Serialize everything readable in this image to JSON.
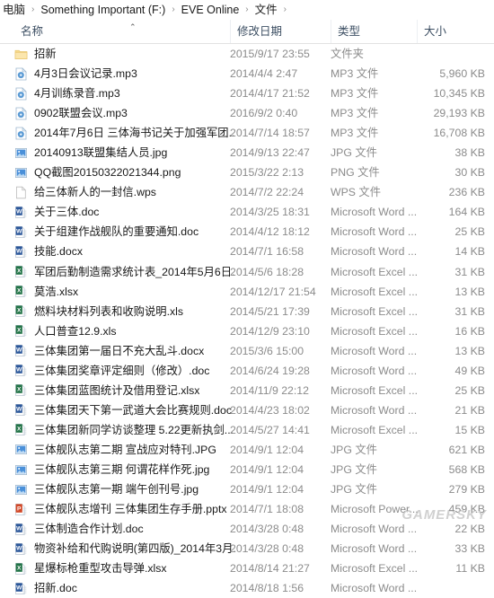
{
  "window": {
    "breadcrumb": {
      "separator": "›",
      "items": [
        "电脑",
        "Something Important (F:)",
        "EVE Online",
        "文件"
      ],
      "trailing_separator": "›"
    }
  },
  "columns": {
    "name": "名称",
    "date_modified": "修改日期",
    "type": "类型",
    "size": "大小",
    "sort_indicator": "⌃"
  },
  "watermark": "GAMERSKY",
  "icon_colors": {
    "folder": "#f6d98a",
    "folder_edge": "#e8c46b",
    "mp3": "#5b9bd5",
    "image": "#4a90d9",
    "word": "#2b579a",
    "excel": "#217346",
    "powerpoint": "#d24726",
    "generic": "#c8c8c8"
  },
  "files": [
    {
      "icon": "folder-icon",
      "name": "招新",
      "date": "2015/9/17 23:55",
      "type": "文件夹",
      "size": ""
    },
    {
      "icon": "mp3-icon",
      "name": "4月3日会议记录.mp3",
      "date": "2014/4/4 2:47",
      "type": "MP3 文件",
      "size": "5,960 KB"
    },
    {
      "icon": "mp3-icon",
      "name": "4月训练录音.mp3",
      "date": "2014/4/17 21:52",
      "type": "MP3 文件",
      "size": "10,345 KB"
    },
    {
      "icon": "mp3-icon",
      "name": "0902联盟会议.mp3",
      "date": "2016/9/2 0:40",
      "type": "MP3 文件",
      "size": "29,193 KB"
    },
    {
      "icon": "mp3-icon",
      "name": "2014年7月6日 三体海书记关于加强军团...",
      "date": "2014/7/14 18:57",
      "type": "MP3 文件",
      "size": "16,708 KB"
    },
    {
      "icon": "image-icon",
      "name": "20140913联盟集结人员.jpg",
      "date": "2014/9/13 22:47",
      "type": "JPG 文件",
      "size": "38 KB"
    },
    {
      "icon": "image-icon",
      "name": "QQ截图20150322021344.png",
      "date": "2015/3/22 2:13",
      "type": "PNG 文件",
      "size": "30 KB"
    },
    {
      "icon": "generic-icon",
      "name": "给三体新人的一封信.wps",
      "date": "2014/7/2 22:24",
      "type": "WPS 文件",
      "size": "236 KB"
    },
    {
      "icon": "word-icon",
      "name": "关于三体.doc",
      "date": "2014/3/25 18:31",
      "type": "Microsoft Word ...",
      "size": "164 KB"
    },
    {
      "icon": "word-icon",
      "name": "关于组建作战舰队的重要通知.doc",
      "date": "2014/4/12 18:12",
      "type": "Microsoft Word ...",
      "size": "25 KB"
    },
    {
      "icon": "word-icon",
      "name": "技能.docx",
      "date": "2014/7/1 16:58",
      "type": "Microsoft Word ...",
      "size": "14 KB"
    },
    {
      "icon": "excel-icon",
      "name": "军团后勤制造需求统计表_2014年5月6日...",
      "date": "2014/5/6 18:28",
      "type": "Microsoft Excel ...",
      "size": "31 KB"
    },
    {
      "icon": "excel-icon",
      "name": "莫浩.xlsx",
      "date": "2014/12/17 21:54",
      "type": "Microsoft Excel ...",
      "size": "13 KB"
    },
    {
      "icon": "excel-icon",
      "name": "燃料块材料列表和收购说明.xls",
      "date": "2014/5/21 17:39",
      "type": "Microsoft Excel ...",
      "size": "31 KB"
    },
    {
      "icon": "excel-icon",
      "name": "人口普查12.9.xls",
      "date": "2014/12/9 23:10",
      "type": "Microsoft Excel ...",
      "size": "16 KB"
    },
    {
      "icon": "word-icon",
      "name": "三体集团第一届日不充大乱斗.docx",
      "date": "2015/3/6 15:00",
      "type": "Microsoft Word ...",
      "size": "13 KB"
    },
    {
      "icon": "word-icon",
      "name": "三体集团奖章评定细则（修改）.doc",
      "date": "2014/6/24 19:28",
      "type": "Microsoft Word ...",
      "size": "49 KB"
    },
    {
      "icon": "excel-icon",
      "name": "三体集团蓝图统计及借用登记.xlsx",
      "date": "2014/11/9 22:12",
      "type": "Microsoft Excel ...",
      "size": "25 KB"
    },
    {
      "icon": "word-icon",
      "name": "三体集团天下第一武道大会比赛规则.doc",
      "date": "2014/4/23 18:02",
      "type": "Microsoft Word ...",
      "size": "21 KB"
    },
    {
      "icon": "excel-icon",
      "name": "三体集团新同学访谈整理 5.22更新执剑...",
      "date": "2014/5/27 14:41",
      "type": "Microsoft Excel ...",
      "size": "15 KB"
    },
    {
      "icon": "image-icon",
      "name": "三体舰队志第二期 宣战应对特刊.JPG",
      "date": "2014/9/1 12:04",
      "type": "JPG 文件",
      "size": "621 KB"
    },
    {
      "icon": "image-icon",
      "name": "三体舰队志第三期 何谓花样作死.jpg",
      "date": "2014/9/1 12:04",
      "type": "JPG 文件",
      "size": "568 KB"
    },
    {
      "icon": "image-icon",
      "name": "三体舰队志第一期 端午创刊号.jpg",
      "date": "2014/9/1 12:04",
      "type": "JPG 文件",
      "size": "279 KB"
    },
    {
      "icon": "powerpoint-icon",
      "name": "三体舰队志增刊 三体集团生存手册.pptx",
      "date": "2014/7/1 18:08",
      "type": "Microsoft Power...",
      "size": "459 KB"
    },
    {
      "icon": "word-icon",
      "name": "三体制造合作计划.doc",
      "date": "2014/3/28 0:48",
      "type": "Microsoft Word ...",
      "size": "22 KB"
    },
    {
      "icon": "word-icon",
      "name": "物资补给和代购说明(第四版)_2014年3月...",
      "date": "2014/3/28 0:48",
      "type": "Microsoft Word ...",
      "size": "33 KB"
    },
    {
      "icon": "excel-icon",
      "name": "星爆标枪重型攻击导弹.xlsx",
      "date": "2014/8/14 21:27",
      "type": "Microsoft Excel ...",
      "size": "11 KB"
    },
    {
      "icon": "word-icon",
      "name": "招新.doc",
      "date": "2014/8/18 1:56",
      "type": "Microsoft Word ...",
      "size": ""
    }
  ]
}
